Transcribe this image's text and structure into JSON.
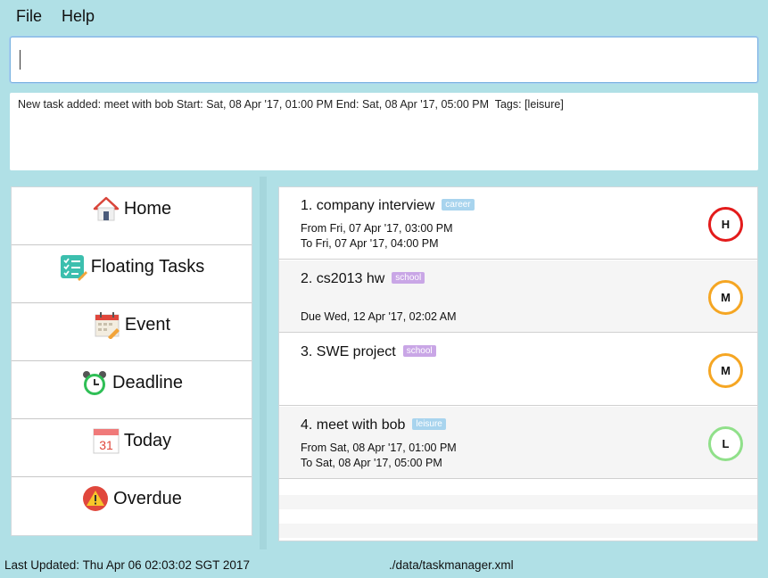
{
  "menu": {
    "file": "File",
    "help": "Help"
  },
  "command": {
    "value": ""
  },
  "result": {
    "text": "New task added: meet with bob Start: Sat, 08 Apr '17, 01:00 PM End: Sat, 08 Apr '17, 05:00 PM  Tags: [leisure]"
  },
  "nav": {
    "items": [
      {
        "label": "Home",
        "icon": "home-icon"
      },
      {
        "label": "Floating Tasks",
        "icon": "checklist-icon"
      },
      {
        "label": "Event",
        "icon": "calendar-pencil-icon"
      },
      {
        "label": "Deadline",
        "icon": "alarm-clock-icon"
      },
      {
        "label": "Today",
        "icon": "calendar-31-icon",
        "icon_text": "31"
      },
      {
        "label": "Overdue",
        "icon": "warning-icon"
      }
    ]
  },
  "tasks": [
    {
      "title": "1. company interview",
      "tag": "career",
      "line1": "From Fri, 07 Apr '17, 03:00 PM",
      "line2": "To Fri, 07 Apr '17, 04:00 PM",
      "priority": "H",
      "priority_color": "#e31b1b"
    },
    {
      "title": "2. cs2013 hw",
      "tag": "school",
      "line1": "",
      "line2": "Due Wed, 12 Apr '17, 02:02 AM",
      "priority": "M",
      "priority_color": "#f5a623"
    },
    {
      "title": "3. SWE project",
      "tag": "school",
      "line1": "",
      "line2": "",
      "priority": "M",
      "priority_color": "#f5a623"
    },
    {
      "title": "4. meet with bob",
      "tag": "leisure",
      "line1": "From Sat, 08 Apr '17, 01:00 PM",
      "line2": "To Sat, 08 Apr '17, 05:00 PM",
      "priority": "L",
      "priority_color": "#90e08a"
    }
  ],
  "status": {
    "last_updated": "Last Updated: Thu Apr 06 02:03:02 SGT 2017",
    "path": "./data/taskmanager.xml"
  }
}
